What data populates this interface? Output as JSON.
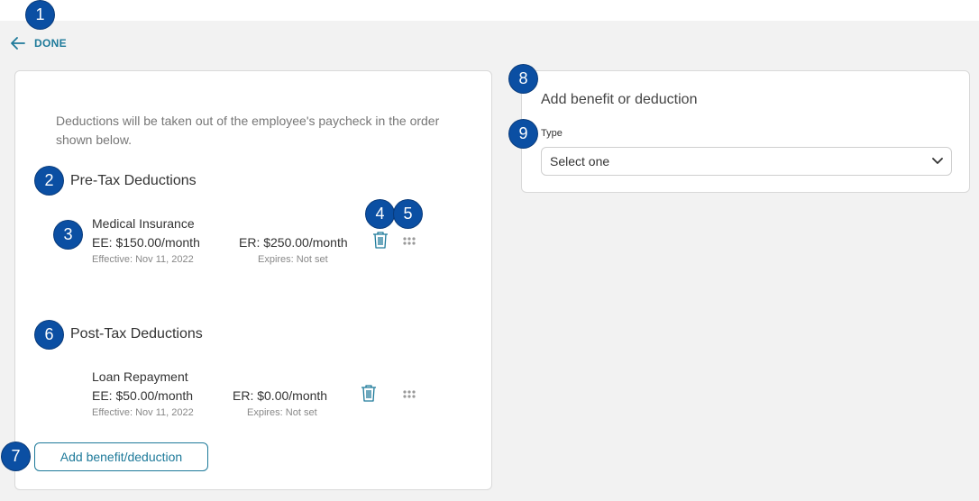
{
  "header": {
    "done_label": "DONE"
  },
  "left_panel": {
    "intro": "Deductions will be taken out of the employee's paycheck in the order shown below.",
    "pre_tax": {
      "title": "Pre-Tax Deductions",
      "items": [
        {
          "name": "Medical Insurance",
          "ee": "EE: $150.00/month",
          "er": "ER: $250.00/month",
          "effective": "Effective: Nov 11, 2022",
          "expires": "Expires: Not set"
        }
      ]
    },
    "post_tax": {
      "title": "Post-Tax Deductions",
      "items": [
        {
          "name": "Loan Repayment",
          "ee": "EE: $50.00/month",
          "er": "ER: $0.00/month",
          "effective": "Effective: Nov 11, 2022",
          "expires": "Expires: Not set"
        }
      ]
    },
    "add_button": "Add benefit/deduction"
  },
  "right_panel": {
    "title": "Add benefit or deduction",
    "type_label": "Type",
    "type_value": "Select one"
  },
  "callouts": [
    "1",
    "2",
    "3",
    "4",
    "5",
    "6",
    "7",
    "8",
    "9"
  ],
  "icons": {
    "back": "arrow-left-icon",
    "delete": "trash-icon",
    "drag": "drag-handle-icon",
    "dropdown": "chevron-down-icon"
  },
  "colors": {
    "accent": "#1e7a9a",
    "badge": "#0b4fa3",
    "background": "#f2f2f2"
  }
}
